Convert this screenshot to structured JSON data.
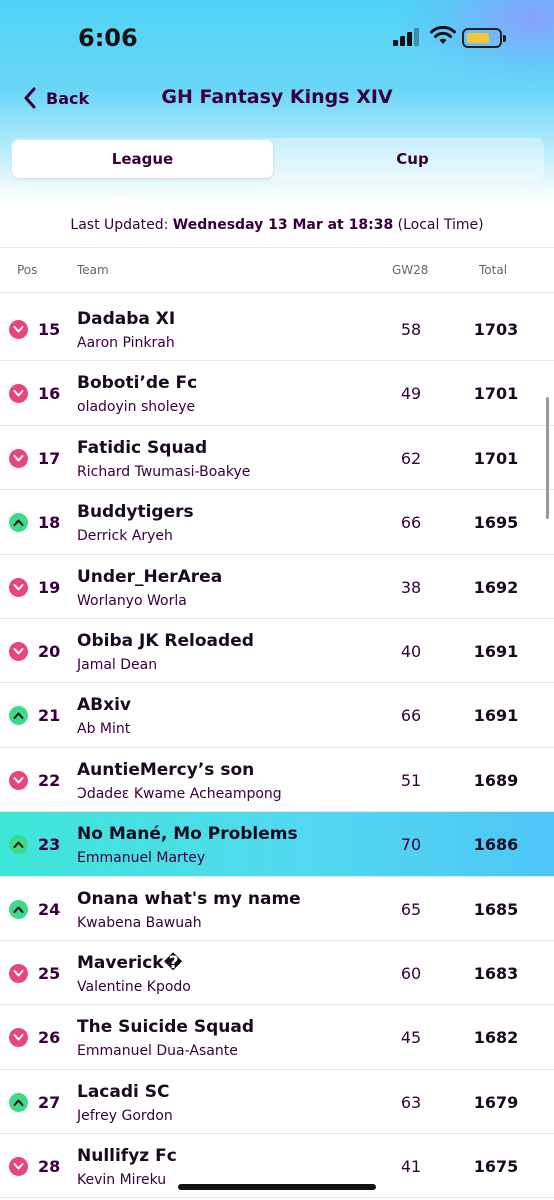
{
  "status": {
    "time": "6:06"
  },
  "nav": {
    "back_label": "Back",
    "title": "GH Fantasy Kings XIV"
  },
  "tabs": {
    "league": "League",
    "cup": "Cup"
  },
  "updated": {
    "prefix": "Last Updated:",
    "date": "Wednesday 13 Mar at 18:38",
    "suffix": "(Local Time)"
  },
  "columns": {
    "pos": "Pos",
    "team": "Team",
    "gw": "GW28",
    "total": "Total"
  },
  "colors": {
    "accent": "#37003c",
    "up": "#3bdb8a",
    "down": "#e8457f",
    "highlight": "#3ee6d8"
  },
  "rows": [
    {
      "pos": "15",
      "move": "down",
      "team": "Dadaba XI",
      "manager": "Aaron Pinkrah",
      "gw": "58",
      "total": "1703"
    },
    {
      "pos": "16",
      "move": "down",
      "team": "Boboti’de Fc",
      "manager": "oladoyin sholeye",
      "gw": "49",
      "total": "1701"
    },
    {
      "pos": "17",
      "move": "down",
      "team": "Fatidic Squad",
      "manager": "Richard Twumasi-Boakye",
      "gw": "62",
      "total": "1701"
    },
    {
      "pos": "18",
      "move": "up",
      "team": "Buddytigers",
      "manager": "Derrick Aryeh",
      "gw": "66",
      "total": "1695"
    },
    {
      "pos": "19",
      "move": "down",
      "team": "Under_HerArea",
      "manager": "Worlanyo Worla",
      "gw": "38",
      "total": "1692"
    },
    {
      "pos": "20",
      "move": "down",
      "team": "Obiba JK Reloaded",
      "manager": "Jamal Dean",
      "gw": "40",
      "total": "1691"
    },
    {
      "pos": "21",
      "move": "up",
      "team": "ABxiv",
      "manager": "Ab Mint",
      "gw": "66",
      "total": "1691"
    },
    {
      "pos": "22",
      "move": "down",
      "team": "AuntieMercy’s son",
      "manager": "Ɔdadeɛ Kwame Acheampong",
      "gw": "51",
      "total": "1689"
    },
    {
      "pos": "23",
      "move": "up",
      "team": "No Mané, Mo Problems",
      "manager": "Emmanuel Martey",
      "gw": "70",
      "total": "1686",
      "highlight": true
    },
    {
      "pos": "24",
      "move": "up",
      "team": "Onana what's my name",
      "manager": "Kwabena Bawuah",
      "gw": "65",
      "total": "1685"
    },
    {
      "pos": "25",
      "move": "down",
      "team": "Maverick�",
      "manager": "Valentine Kpodo",
      "gw": "60",
      "total": "1683"
    },
    {
      "pos": "26",
      "move": "down",
      "team": "The Suicide Squad",
      "manager": "Emmanuel Dua-Asante",
      "gw": "45",
      "total": "1682"
    },
    {
      "pos": "27",
      "move": "up",
      "team": "Lacadi SC",
      "manager": "Jefrey Gordon",
      "gw": "63",
      "total": "1679"
    },
    {
      "pos": "28",
      "move": "down",
      "team": "Nullifyz Fc",
      "manager": "Kevin Mireku",
      "gw": "41",
      "total": "1675"
    }
  ]
}
